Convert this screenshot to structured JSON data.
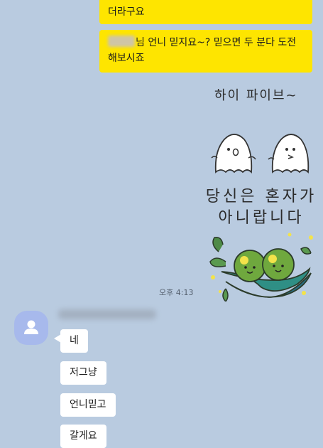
{
  "messages_me": {
    "partial_text": "더라구요",
    "believe_prefix": "",
    "believe_text": "님 언니 믿지요~? 믿으면 두 분다 도전 해보시죠",
    "sticker_caption": "하이 파이브~",
    "sticker_message": "당신은 혼자가 아니랍니다",
    "time": "오후 4:13"
  },
  "other": {
    "replies": [
      "네",
      "저그냥",
      "언니믿고",
      "갈게요"
    ]
  },
  "colors": {
    "background": "#b9cbe0",
    "my_bubble": "#fee500",
    "their_bubble": "#ffffff",
    "avatar": "#a7b9ec"
  },
  "icons": {
    "avatar": "default-profile-icon",
    "sticker": "ghosts-and-peas-sticker"
  }
}
